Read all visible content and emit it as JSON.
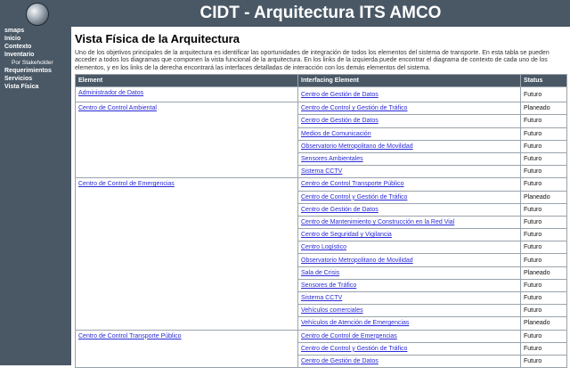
{
  "header": {
    "title": "CIDT - Arquitectura ITS AMCO"
  },
  "sidebar": {
    "items": [
      {
        "label": "smaps",
        "sub": false
      },
      {
        "label": "Inicio",
        "sub": false
      },
      {
        "label": "Contexto",
        "sub": false
      },
      {
        "label": "Inventario",
        "sub": false
      },
      {
        "label": "Por Stakeholder",
        "sub": true
      },
      {
        "label": "Requerimientos",
        "sub": false
      },
      {
        "label": "Servicios",
        "sub": false
      },
      {
        "label": "Vista Física",
        "sub": false
      }
    ]
  },
  "main": {
    "heading": "Vista Física de la Arquitectura",
    "intro": "Uno de los objetivos principales de la arquitectura es identificar las oportunidades de integración de todos los elementos del sistema de transporte. En esta tabla se pueden acceder a todos los diagramas que componen la vista funcional de la arquitectura. En los links de la izquierda puede encontrar el diagrama de contexto de cada uno de los elementos, y en los links de la derecha encontrará las interfaces detalladas de interacción con los demás elementos del sistema.",
    "table": {
      "headers": [
        "Element",
        "Interfacing Element",
        "Status"
      ],
      "groups": [
        {
          "element": "Administrador de Datos",
          "rows": [
            {
              "iface": "Centro de Gestión de Datos",
              "status": "Futuro"
            }
          ]
        },
        {
          "element": "Centro de Control Ambiental",
          "rows": [
            {
              "iface": "Centro de Control y Gestión de Tráfico",
              "status": "Planeado"
            },
            {
              "iface": "Centro de Gestión de Datos",
              "status": "Futuro"
            },
            {
              "iface": "Medios de Comunicación",
              "status": "Futuro"
            },
            {
              "iface": "Observatorio Metropolitano de Movilidad",
              "status": "Futuro"
            },
            {
              "iface": "Sensores Ambientales",
              "status": "Futuro"
            },
            {
              "iface": "Sistema CCTV",
              "status": "Futuro"
            }
          ]
        },
        {
          "element": "Centro de Control de Emergencias",
          "rows": [
            {
              "iface": "Centro de Control Transporte Público",
              "status": "Futuro"
            },
            {
              "iface": "Centro de Control y Gestión de Tráfico",
              "status": "Planeado"
            },
            {
              "iface": "Centro de Gestión de Datos",
              "status": "Futuro"
            },
            {
              "iface": "Centro de Mantenimiento y Construcción en la Red Vial",
              "status": "Futuro"
            },
            {
              "iface": "Centro de Seguridad y Vigilancia",
              "status": "Futuro"
            },
            {
              "iface": "Centro Logístico",
              "status": "Futuro"
            },
            {
              "iface": "Observatorio Metropolitano de Movilidad",
              "status": "Futuro"
            },
            {
              "iface": "Sala de Crisis",
              "status": "Planeado"
            },
            {
              "iface": "Sensores de Tráfico",
              "status": "Futuro"
            },
            {
              "iface": "Sistema CCTV",
              "status": "Futuro"
            },
            {
              "iface": "Vehículos comerciales",
              "status": "Futuro"
            },
            {
              "iface": "Vehículos de Atención de Emergencias",
              "status": "Planeado"
            }
          ]
        },
        {
          "element": "Centro de Control Transporte Público",
          "rows": [
            {
              "iface": "Centro de Control de Emergencias",
              "status": "Futuro"
            },
            {
              "iface": "Centro de Control y Gestión de Tráfico",
              "status": "Futuro"
            },
            {
              "iface": "Centro de Gestión de Datos",
              "status": "Futuro"
            }
          ]
        }
      ]
    }
  }
}
